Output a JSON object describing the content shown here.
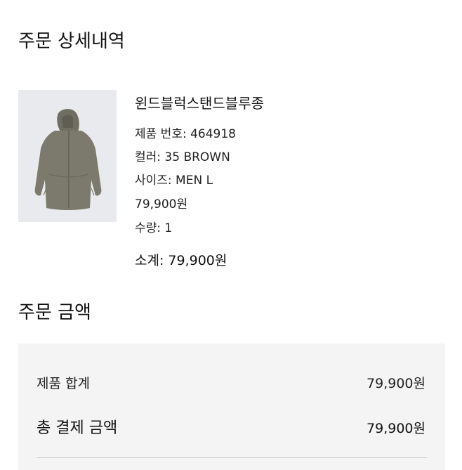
{
  "order_detail": {
    "title": "주문 상세내역",
    "product": {
      "name": "윈드블럭스탠드블루종",
      "product_number_label": "제품 번호: 464918",
      "color_label": "컬러: 35 BROWN",
      "size_label": "사이즈: MEN L",
      "price": "79,900원",
      "quantity_label": "수량: 1",
      "subtotal_label": "소계: 79,900원",
      "image_icon": "hooded-jacket-image"
    }
  },
  "order_amount": {
    "title": "주문 금액",
    "rows": [
      {
        "label": "제품 합계",
        "value": "79,900원"
      },
      {
        "label": "총 결제 금액",
        "value": "79,900원"
      }
    ]
  },
  "colors": {
    "image_background": "#e8eaed",
    "jacket": "#7b7a6c",
    "summary_background": "#f4f4f4"
  }
}
